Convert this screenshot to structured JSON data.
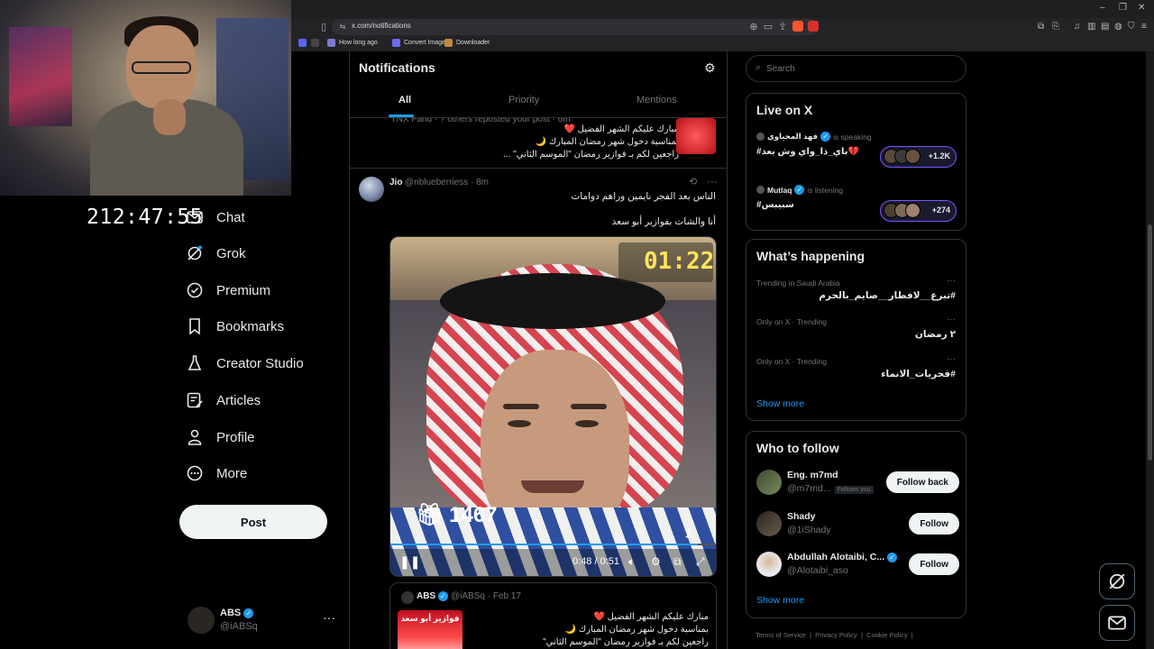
{
  "timer": "212:47:55",
  "browser": {
    "url": "x.com/notifications",
    "bookmarks": [
      "How long ago",
      "Convert Image",
      "Downloader"
    ]
  },
  "nav": {
    "items": [
      {
        "label": "Chat",
        "icon": "mail-icon"
      },
      {
        "label": "Grok",
        "icon": "grok-icon"
      },
      {
        "label": "Premium",
        "icon": "verified-badge-icon"
      },
      {
        "label": "Bookmarks",
        "icon": "bookmark-icon"
      },
      {
        "label": "Creator Studio",
        "icon": "flask-icon"
      },
      {
        "label": "Articles",
        "icon": "article-icon"
      },
      {
        "label": "Profile",
        "icon": "person-icon"
      },
      {
        "label": "More",
        "icon": "more-circle-icon"
      }
    ],
    "post_label": "Post",
    "account": {
      "name": "ABS",
      "handle": "@iABSq"
    }
  },
  "center": {
    "title": "Notifications",
    "tabs": [
      "All",
      "Priority",
      "Mentions"
    ],
    "prev_post": {
      "meta": "YNX Fahd · ? others reposted your post · 6m",
      "lines": [
        "مبارك عليكم الشهر الفضيل ❤️",
        "بمناسبة دخول شهر رمضان المبارك 🌙",
        "راجعين لكم بـ فوازير رمضان \"الموسم الثاني\" ..."
      ]
    },
    "post": {
      "name": "Jio",
      "handle": "@nblueberriess · 8m",
      "line1": "الناس بعد الفجر نايمين وراهم دوامات",
      "line2": "أنا والشات بفوازير أبو سعد",
      "video": {
        "clock": "01:22",
        "gifts": "1467",
        "time": "0:48 / 0:51",
        "progress": 0.94
      },
      "quote": {
        "name": "ABS",
        "handle": "@iABSq · Feb 17",
        "lines": [
          "مبارك عليكم الشهر الفضيل ❤️",
          "بمناسبة دخول شهر رمضان المبارك 🌙",
          "راجعين لكم بـ فوازير رمضان \"الموسم الثاني\""
        ],
        "thumb_text": "فوازير أبو سعد"
      }
    }
  },
  "right": {
    "search_placeholder": "Search",
    "live": {
      "title": "Live on X",
      "items": [
        {
          "host": "فهد المحياوي",
          "status": "is speaking",
          "topic": "#باي_ذا_واي وش بعد💔",
          "count": "+1.2K"
        },
        {
          "host": "Mutlaq",
          "status": "is listening",
          "topic": "#سبيبس",
          "count": "+274"
        }
      ]
    },
    "happening": {
      "title": "What’s happening",
      "trends": [
        {
          "meta": "Trending in Saudi Arabia",
          "name": "#تبرع__لافطار__صايم_بالحرم"
        },
        {
          "meta": "Only on X · Trending",
          "name": "٢ رمضان"
        },
        {
          "meta": "Only on X · Trending",
          "name": "#فحريات_الانماء"
        }
      ],
      "show_more": "Show more"
    },
    "who_to_follow": {
      "title": "Who to follow",
      "users": [
        {
          "name": "Eng. m7md",
          "handle": "@m7md...",
          "badge": "Follows you",
          "button": "Follow back"
        },
        {
          "name": "Shady",
          "handle": "@1iShady",
          "badge": "",
          "button": "Follow"
        },
        {
          "name": "Abdullah Alotaibi, C...",
          "handle": "@Alotaibi_aso",
          "badge": "",
          "button": "Follow"
        }
      ],
      "show_more": "Show more"
    },
    "footer": [
      "Terms of Service",
      "Privacy Policy",
      "Cookie Policy"
    ]
  }
}
